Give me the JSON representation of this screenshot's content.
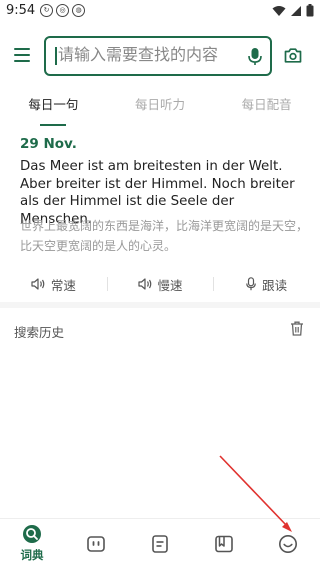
{
  "status_bar": {
    "time": "9:54"
  },
  "search": {
    "placeholder": "请输入需要查找的内容"
  },
  "tabs": [
    {
      "label": "每日一句",
      "active": true
    },
    {
      "label": "每日听力",
      "active": false
    },
    {
      "label": "每日配音",
      "active": false
    }
  ],
  "daily": {
    "date": "29 Nov.",
    "sentence_en": "Das Meer ist am breitesten in der Welt. Aber breiter ist der Himmel. Noch breiter als der Himmel ist die Seele der Menschen.",
    "sentence_cn": "世界上最宽阔的东西是海洋，比海洋更宽阔的是天空，比天空更宽阔的是人的心灵。"
  },
  "read_buttons": [
    {
      "label": "常速",
      "icon": "speaker-icon"
    },
    {
      "label": "慢速",
      "icon": "speaker-icon"
    },
    {
      "label": "跟读",
      "icon": "mic-icon"
    }
  ],
  "history": {
    "title": "搜索历史"
  },
  "bottom_nav": {
    "active_label": "词典",
    "items": [
      "search-icon",
      "robot-icon",
      "notes-icon",
      "book-icon",
      "smile-icon"
    ]
  },
  "colors": {
    "accent": "#1e6b4a",
    "arrow": "#e0322f"
  }
}
